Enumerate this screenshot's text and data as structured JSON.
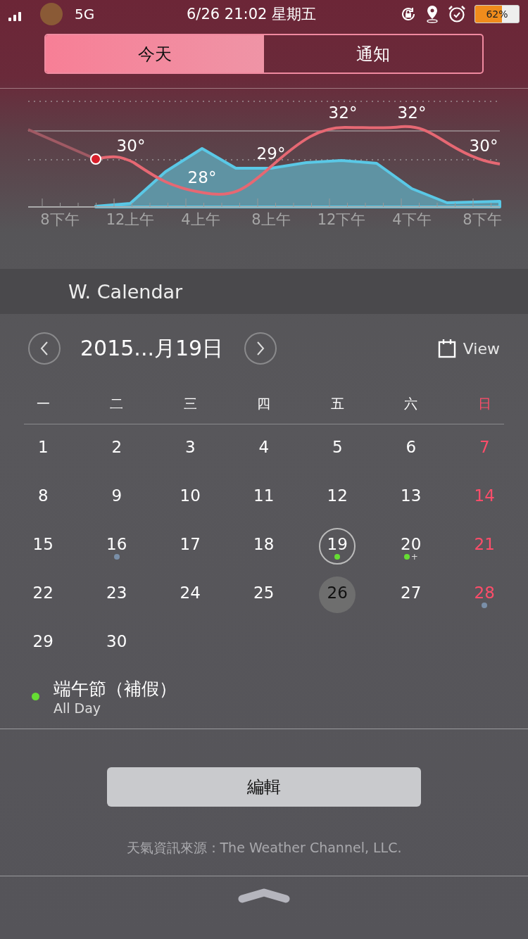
{
  "status_bar": {
    "network": "5G",
    "time": "6/26 21:02 星期五",
    "battery": "62%"
  },
  "tabs": [
    {
      "label": "今天",
      "selected": true
    },
    {
      "label": "通知",
      "selected": false
    }
  ],
  "weather": {
    "temps": [
      "30°",
      "28°",
      "29°",
      "32°",
      "32°",
      "30°"
    ],
    "x_labels": [
      "8下午",
      "12上午",
      "4上午",
      "8上午",
      "12下午",
      "4下午",
      "8下午"
    ]
  },
  "calendar": {
    "widget_title": "W. Calendar",
    "title": "2015...月19日",
    "view": "View",
    "weekdays": [
      {
        "label": "一",
        "kind": "weekday"
      },
      {
        "label": "二",
        "kind": "weekday"
      },
      {
        "label": "三",
        "kind": "weekday"
      },
      {
        "label": "四",
        "kind": "weekday"
      },
      {
        "label": "五",
        "kind": "weekday"
      },
      {
        "label": "六",
        "kind": "weekday"
      },
      {
        "label": "日",
        "kind": "sunday"
      }
    ],
    "weeks": [
      [
        {
          "day": "1",
          "kind": "weekday",
          "selected": false,
          "today": false
        },
        {
          "day": "2",
          "kind": "weekday",
          "selected": false,
          "today": false
        },
        {
          "day": "3",
          "kind": "weekday",
          "selected": false,
          "today": false
        },
        {
          "day": "4",
          "kind": "weekday",
          "selected": false,
          "today": false
        },
        {
          "day": "5",
          "kind": "weekday",
          "selected": false,
          "today": false
        },
        {
          "day": "6",
          "kind": "weekday",
          "selected": false,
          "today": false
        },
        {
          "day": "7",
          "kind": "sunday",
          "selected": false,
          "today": false
        }
      ],
      [
        {
          "day": "8",
          "kind": "weekday",
          "selected": false,
          "today": false
        },
        {
          "day": "9",
          "kind": "weekday",
          "selected": false,
          "today": false
        },
        {
          "day": "10",
          "kind": "weekday",
          "selected": false,
          "today": false
        },
        {
          "day": "11",
          "kind": "weekday",
          "selected": false,
          "today": false
        },
        {
          "day": "12",
          "kind": "weekday",
          "selected": false,
          "today": false
        },
        {
          "day": "13",
          "kind": "weekday",
          "selected": false,
          "today": false
        },
        {
          "day": "14",
          "kind": "sunday",
          "selected": false,
          "today": false
        }
      ],
      [
        {
          "day": "15",
          "kind": "weekday",
          "selected": false,
          "today": false
        },
        {
          "day": "16",
          "kind": "weekday",
          "selected": false,
          "today": false,
          "dots": [
            {
              "color": "#7a8fa8"
            }
          ]
        },
        {
          "day": "17",
          "kind": "weekday",
          "selected": false,
          "today": false
        },
        {
          "day": "18",
          "kind": "weekday",
          "selected": false,
          "today": false
        },
        {
          "day": "19",
          "kind": "weekday",
          "selected": true,
          "today": false,
          "dots": [
            {
              "color": "#66dd33"
            }
          ]
        },
        {
          "day": "20",
          "kind": "weekday",
          "selected": false,
          "today": false,
          "dots": [
            {
              "color": "#66dd33"
            }
          ],
          "more": "+"
        },
        {
          "day": "21",
          "kind": "sunday",
          "selected": false,
          "today": false
        }
      ],
      [
        {
          "day": "22",
          "kind": "weekday",
          "selected": false,
          "today": false
        },
        {
          "day": "23",
          "kind": "weekday",
          "selected": false,
          "today": false
        },
        {
          "day": "24",
          "kind": "weekday",
          "selected": false,
          "today": false
        },
        {
          "day": "25",
          "kind": "weekday",
          "selected": false,
          "today": false
        },
        {
          "day": "26",
          "kind": "weekday",
          "selected": false,
          "today": true
        },
        {
          "day": "27",
          "kind": "weekday",
          "selected": false,
          "today": false
        },
        {
          "day": "28",
          "kind": "sunday",
          "selected": false,
          "today": false,
          "dots": [
            {
              "color": "#7a8fa8"
            }
          ]
        }
      ],
      [
        {
          "day": "29",
          "kind": "weekday",
          "selected": false,
          "today": false
        },
        {
          "day": "30",
          "kind": "weekday",
          "selected": false,
          "today": false
        }
      ]
    ],
    "events": [
      {
        "title": "端午節（補假）",
        "time": "All Day",
        "color": "#66dd33"
      }
    ]
  },
  "edit_button": "編輯",
  "source": "天氣資訊來源：The Weather Channel, LLC."
}
